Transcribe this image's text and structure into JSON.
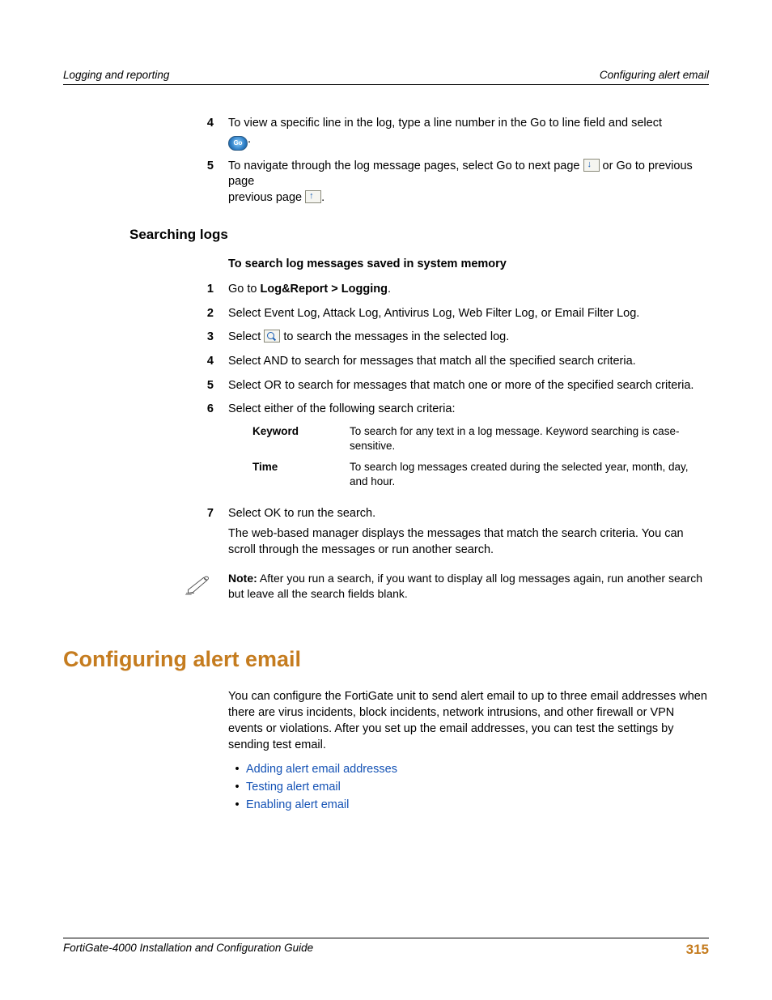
{
  "header": {
    "left": "Logging and reporting",
    "right": "Configuring alert email"
  },
  "top_steps": {
    "s4": {
      "num": "4",
      "text_a": "To view a specific line in the log, type a line number in the Go to line field and select ",
      "text_b": "."
    },
    "s5": {
      "num": "5",
      "text_a": "To navigate through the log message pages, select Go to next page ",
      "text_b": " or Go to previous page ",
      "text_c": "."
    },
    "go_label": "Go"
  },
  "searching": {
    "heading": "Searching logs",
    "subheading": "To search log messages saved in system memory",
    "s1": {
      "num": "1",
      "pre": "Go to ",
      "bold": "Log&Report > Logging",
      "post": "."
    },
    "s2": {
      "num": "2",
      "text": "Select Event Log, Attack Log, Antivirus Log, Web Filter Log, or Email Filter Log."
    },
    "s3": {
      "num": "3",
      "text_a": "Select ",
      "text_b": " to search the messages in the selected log."
    },
    "s4": {
      "num": "4",
      "text": "Select AND to search for messages that match all the specified search criteria."
    },
    "s5": {
      "num": "5",
      "text": "Select OR to search for messages that match one or more of the specified search criteria."
    },
    "s6": {
      "num": "6",
      "text": "Select either of the following search criteria:"
    },
    "criteria": {
      "keyword": {
        "k": "Keyword",
        "v": "To search for any text in a log message. Keyword searching is case-sensitive."
      },
      "time": {
        "k": "Time",
        "v": "To search log messages created during the selected year, month, day, and hour."
      }
    },
    "s7": {
      "num": "7",
      "line1": "Select OK to run the search.",
      "line2": "The web-based manager displays the messages that match the search criteria. You can scroll through the messages or run another search."
    },
    "note": {
      "label": "Note:",
      "text": " After you run a search, if you want to display all log messages again, run another search but leave all the search fields blank."
    }
  },
  "alert": {
    "heading": "Configuring alert email",
    "intro": "You can configure the FortiGate unit to send alert email to up to three email addresses when there are virus incidents, block incidents, network intrusions, and other firewall or VPN events or violations. After you set up the email addresses, you can test the settings by sending test email.",
    "bullets": {
      "b1": "Adding alert email addresses",
      "b2": "Testing alert email",
      "b3": "Enabling alert email"
    }
  },
  "footer": {
    "left": "FortiGate-4000 Installation and Configuration Guide",
    "right": "315"
  }
}
